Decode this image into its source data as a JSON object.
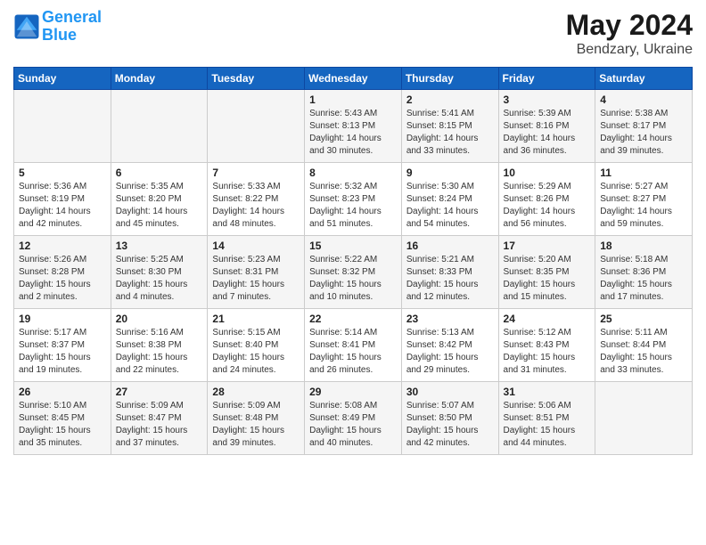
{
  "logo": {
    "line1": "General",
    "line2": "Blue"
  },
  "title": {
    "month": "May 2024",
    "location": "Bendzary, Ukraine"
  },
  "weekdays": [
    "Sunday",
    "Monday",
    "Tuesday",
    "Wednesday",
    "Thursday",
    "Friday",
    "Saturday"
  ],
  "weeks": [
    [
      {
        "day": "",
        "info": ""
      },
      {
        "day": "",
        "info": ""
      },
      {
        "day": "",
        "info": ""
      },
      {
        "day": "1",
        "info": "Sunrise: 5:43 AM\nSunset: 8:13 PM\nDaylight: 14 hours\nand 30 minutes."
      },
      {
        "day": "2",
        "info": "Sunrise: 5:41 AM\nSunset: 8:15 PM\nDaylight: 14 hours\nand 33 minutes."
      },
      {
        "day": "3",
        "info": "Sunrise: 5:39 AM\nSunset: 8:16 PM\nDaylight: 14 hours\nand 36 minutes."
      },
      {
        "day": "4",
        "info": "Sunrise: 5:38 AM\nSunset: 8:17 PM\nDaylight: 14 hours\nand 39 minutes."
      }
    ],
    [
      {
        "day": "5",
        "info": "Sunrise: 5:36 AM\nSunset: 8:19 PM\nDaylight: 14 hours\nand 42 minutes."
      },
      {
        "day": "6",
        "info": "Sunrise: 5:35 AM\nSunset: 8:20 PM\nDaylight: 14 hours\nand 45 minutes."
      },
      {
        "day": "7",
        "info": "Sunrise: 5:33 AM\nSunset: 8:22 PM\nDaylight: 14 hours\nand 48 minutes."
      },
      {
        "day": "8",
        "info": "Sunrise: 5:32 AM\nSunset: 8:23 PM\nDaylight: 14 hours\nand 51 minutes."
      },
      {
        "day": "9",
        "info": "Sunrise: 5:30 AM\nSunset: 8:24 PM\nDaylight: 14 hours\nand 54 minutes."
      },
      {
        "day": "10",
        "info": "Sunrise: 5:29 AM\nSunset: 8:26 PM\nDaylight: 14 hours\nand 56 minutes."
      },
      {
        "day": "11",
        "info": "Sunrise: 5:27 AM\nSunset: 8:27 PM\nDaylight: 14 hours\nand 59 minutes."
      }
    ],
    [
      {
        "day": "12",
        "info": "Sunrise: 5:26 AM\nSunset: 8:28 PM\nDaylight: 15 hours\nand 2 minutes."
      },
      {
        "day": "13",
        "info": "Sunrise: 5:25 AM\nSunset: 8:30 PM\nDaylight: 15 hours\nand 4 minutes."
      },
      {
        "day": "14",
        "info": "Sunrise: 5:23 AM\nSunset: 8:31 PM\nDaylight: 15 hours\nand 7 minutes."
      },
      {
        "day": "15",
        "info": "Sunrise: 5:22 AM\nSunset: 8:32 PM\nDaylight: 15 hours\nand 10 minutes."
      },
      {
        "day": "16",
        "info": "Sunrise: 5:21 AM\nSunset: 8:33 PM\nDaylight: 15 hours\nand 12 minutes."
      },
      {
        "day": "17",
        "info": "Sunrise: 5:20 AM\nSunset: 8:35 PM\nDaylight: 15 hours\nand 15 minutes."
      },
      {
        "day": "18",
        "info": "Sunrise: 5:18 AM\nSunset: 8:36 PM\nDaylight: 15 hours\nand 17 minutes."
      }
    ],
    [
      {
        "day": "19",
        "info": "Sunrise: 5:17 AM\nSunset: 8:37 PM\nDaylight: 15 hours\nand 19 minutes."
      },
      {
        "day": "20",
        "info": "Sunrise: 5:16 AM\nSunset: 8:38 PM\nDaylight: 15 hours\nand 22 minutes."
      },
      {
        "day": "21",
        "info": "Sunrise: 5:15 AM\nSunset: 8:40 PM\nDaylight: 15 hours\nand 24 minutes."
      },
      {
        "day": "22",
        "info": "Sunrise: 5:14 AM\nSunset: 8:41 PM\nDaylight: 15 hours\nand 26 minutes."
      },
      {
        "day": "23",
        "info": "Sunrise: 5:13 AM\nSunset: 8:42 PM\nDaylight: 15 hours\nand 29 minutes."
      },
      {
        "day": "24",
        "info": "Sunrise: 5:12 AM\nSunset: 8:43 PM\nDaylight: 15 hours\nand 31 minutes."
      },
      {
        "day": "25",
        "info": "Sunrise: 5:11 AM\nSunset: 8:44 PM\nDaylight: 15 hours\nand 33 minutes."
      }
    ],
    [
      {
        "day": "26",
        "info": "Sunrise: 5:10 AM\nSunset: 8:45 PM\nDaylight: 15 hours\nand 35 minutes."
      },
      {
        "day": "27",
        "info": "Sunrise: 5:09 AM\nSunset: 8:47 PM\nDaylight: 15 hours\nand 37 minutes."
      },
      {
        "day": "28",
        "info": "Sunrise: 5:09 AM\nSunset: 8:48 PM\nDaylight: 15 hours\nand 39 minutes."
      },
      {
        "day": "29",
        "info": "Sunrise: 5:08 AM\nSunset: 8:49 PM\nDaylight: 15 hours\nand 40 minutes."
      },
      {
        "day": "30",
        "info": "Sunrise: 5:07 AM\nSunset: 8:50 PM\nDaylight: 15 hours\nand 42 minutes."
      },
      {
        "day": "31",
        "info": "Sunrise: 5:06 AM\nSunset: 8:51 PM\nDaylight: 15 hours\nand 44 minutes."
      },
      {
        "day": "",
        "info": ""
      }
    ]
  ]
}
